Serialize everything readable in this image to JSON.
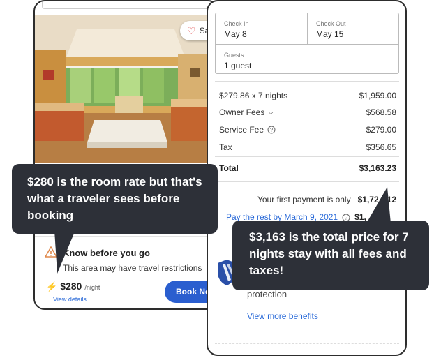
{
  "listing": {
    "save_label": "Sa",
    "know_title": "Know before you go",
    "know_text": "This area may have travel restrictions",
    "price": "$280",
    "price_unit": "/night",
    "view_details": "View details",
    "book_label": "Book Now"
  },
  "booking": {
    "check_in_label": "Check In",
    "check_in_value": "May 8",
    "check_out_label": "Check Out",
    "check_out_value": "May 15",
    "guests_label": "Guests",
    "guests_value": "1 guest",
    "lines": [
      {
        "label": "$279.86 x 7 nights",
        "value": "$1,959.00"
      },
      {
        "label": "Owner Fees",
        "value": "$568.58"
      },
      {
        "label": "Service Fee",
        "value": "$279.00"
      },
      {
        "label": "Tax",
        "value": "$356.65"
      }
    ],
    "total_label": "Total",
    "total_value": "$3,163.23",
    "first_payment_label": "Your first payment is only",
    "first_payment_value": "$1,72",
    "first_payment_tail": "12",
    "pay_rest_label": "Pay the rest by March 9, 2021",
    "pay_rest_value": "$1,",
    "pay_rest_tail": "11",
    "protection_label": "protection",
    "more_benefits": "View more benefits"
  },
  "callouts": {
    "left": "$280 is the room rate but that's what a traveler sees before booking",
    "right": "$3,163 is the total price for 7 nights stay with all fees and taxes!"
  },
  "colors": {
    "accent": "#2a5ecf",
    "link": "#2a6ad8",
    "callout_bg": "#2d3038",
    "warning": "#e0884a"
  }
}
